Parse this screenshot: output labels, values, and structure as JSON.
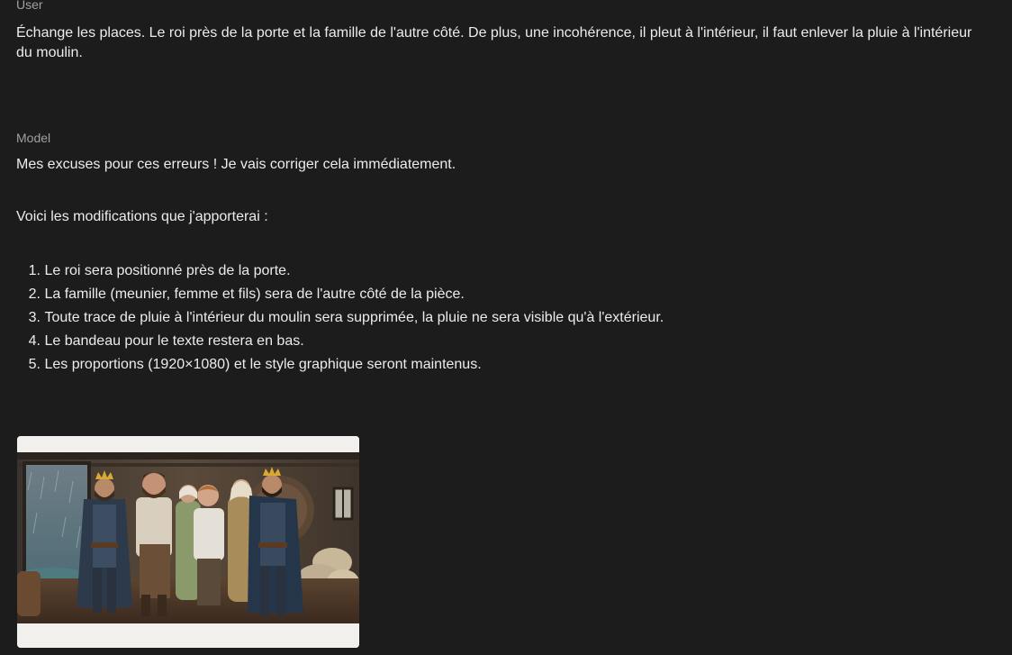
{
  "conversation": {
    "user": {
      "role_label": "User",
      "message": "Échange les places. Le roi près de la porte et la famille de l'autre côté. De plus, une incohérence, il pleut à l'intérieur, il faut enlever la pluie à l'intérieur du moulin."
    },
    "model": {
      "role_label": "Model",
      "intro": "Mes excuses pour ces erreurs ! Je vais corriger cela immédiatement.",
      "lead": "Voici les modifications que j'apporterai :",
      "steps": [
        {
          "num": "1.",
          "text": "Le roi sera positionné près de la porte."
        },
        {
          "num": "2.",
          "text": "La famille (meunier, femme et fils) sera de l'autre côté de la pièce."
        },
        {
          "num": "3.",
          "text": "Toute trace de pluie à l'intérieur du moulin sera supprimée, la pluie ne sera visible qu'à l'extérieur."
        },
        {
          "num": "4.",
          "text": "Le bandeau pour le texte restera en bas."
        },
        {
          "num": "5.",
          "text": "Les proportions (1920×1080) et le style graphique seront maintenus."
        }
      ],
      "image": {
        "subject": "generated illustration: two crowned kings and a peasant family inside a rainy-day mill interior"
      }
    }
  },
  "colors": {
    "background": "#1c1c1c",
    "text": "#ececec",
    "role_label": "#a0a0a0"
  }
}
